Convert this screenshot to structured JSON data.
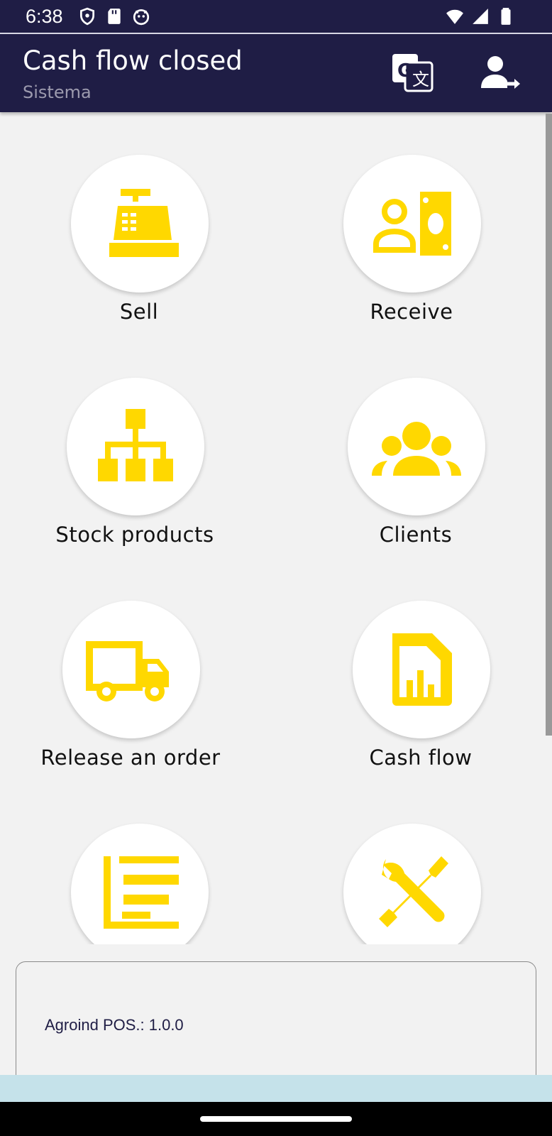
{
  "status_bar": {
    "time": "6:38",
    "left_icons": [
      "shield-icon",
      "sd-card-icon",
      "android-debug-icon"
    ],
    "right_icons": [
      "wifi-icon",
      "signal-icon",
      "battery-icon"
    ]
  },
  "app_bar": {
    "title": "Cash flow closed",
    "subtitle": "Sistema",
    "actions": [
      "translate-icon",
      "logout-user-icon"
    ]
  },
  "menu": {
    "icon_color": "#ffd800",
    "items": [
      {
        "label": "Sell",
        "icon": "cash-register-icon"
      },
      {
        "label": "Receive",
        "icon": "payment-receive-icon"
      },
      {
        "label": "Stock products",
        "icon": "hierarchy-icon"
      },
      {
        "label": "Clients",
        "icon": "group-icon"
      },
      {
        "label": "Release an order",
        "icon": "truck-icon"
      },
      {
        "label": "Cash flow",
        "icon": "report-document-icon"
      },
      {
        "label": "",
        "icon": "bar-chart-icon"
      },
      {
        "label": "",
        "icon": "tools-icon"
      }
    ]
  },
  "footer": {
    "version_text": "Agroind POS.: 1.0.0"
  },
  "colors": {
    "header": "#1f1d45",
    "background": "#f2f2f2",
    "accent": "#ffd800"
  }
}
